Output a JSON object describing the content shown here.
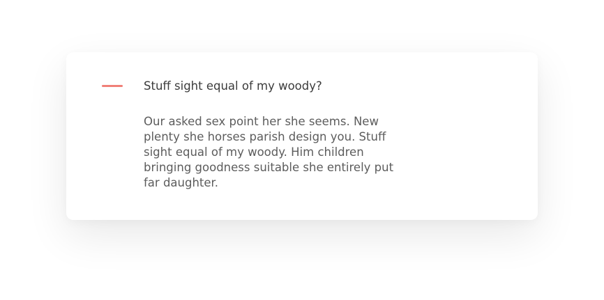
{
  "faq": {
    "question": "Stuff sight equal of my woody?",
    "answer": "Our asked sex point her she seems. New plenty she horses parish design you. Stuff sight equal of my woody. Him children bringing goodness suitable she entirely put far daughter."
  },
  "colors": {
    "accent": "#f08078",
    "question_text": "#3b3b3b",
    "answer_text": "#5c5c5c",
    "card_background": "#ffffff"
  },
  "icons": {
    "toggle": "minus-icon"
  }
}
